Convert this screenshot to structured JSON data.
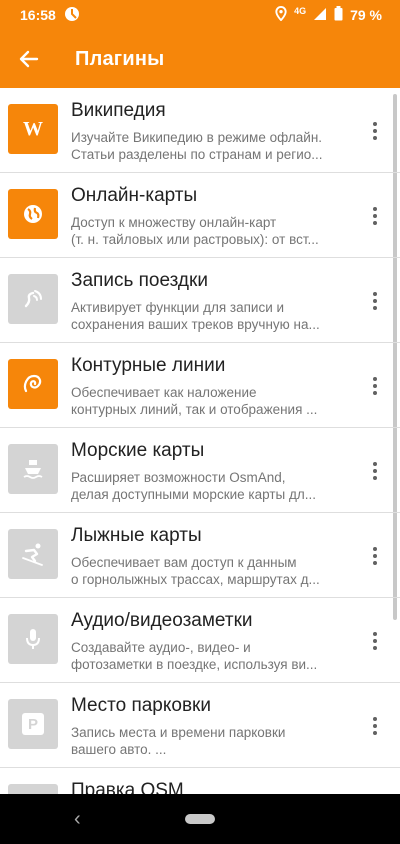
{
  "status": {
    "time": "16:58",
    "network": "4G",
    "battery": "79 %"
  },
  "appbar": {
    "title": "Плагины",
    "back_icon": "arrow-back-icon"
  },
  "colors": {
    "accent": "#f6860a",
    "inactive_icon": "#d4d4d4"
  },
  "plugins": [
    {
      "title": "Википедия",
      "desc1": "Изучайте Википедию в режиме офлайн.",
      "desc2": "Статьи разделены по странам и регио...",
      "icon": "wikipedia-icon",
      "enabled": true
    },
    {
      "title": "Онлайн-карты",
      "desc1": "Доступ к множеству онлайн-карт",
      "desc2": "(т. н. тайловых или растровых): от вст...",
      "icon": "globe-icon",
      "enabled": true
    },
    {
      "title": "Запись поездки",
      "desc1": "Активирует функции для записи и",
      "desc2": "сохранения ваших треков вручную на...",
      "icon": "trip-recording-icon",
      "enabled": false
    },
    {
      "title": "Контурные линии",
      "desc1": "Обеспечивает как наложение",
      "desc2": "контурных линий, так и отображения ...",
      "icon": "contour-lines-icon",
      "enabled": true
    },
    {
      "title": "Морские карты",
      "desc1": "Расширяет возможности OsmAnd,",
      "desc2": "делая доступными морские карты дл...",
      "icon": "ship-icon",
      "enabled": false
    },
    {
      "title": "Лыжные карты",
      "desc1": "Обеспечивает вам доступ к данным",
      "desc2": "о горнолыжных трассах, маршрутах д...",
      "icon": "skier-icon",
      "enabled": false
    },
    {
      "title": "Аудио/видеозаметки",
      "desc1": "Создавайте аудио-, видео- и",
      "desc2": "фотозаметки в поездке, используя ви...",
      "icon": "microphone-icon",
      "enabled": false
    },
    {
      "title": "Место парковки",
      "desc1": "Запись места и времени парковки",
      "desc2": "вашего авто. ...",
      "icon": "parking-icon",
      "enabled": false
    },
    {
      "title": "Правка OSM",
      "desc1": "",
      "desc2": "",
      "icon": "osm-edit-icon",
      "enabled": false
    }
  ],
  "navbar": {
    "back_icon": "nav-back-icon",
    "home_icon": "nav-home-pill"
  }
}
